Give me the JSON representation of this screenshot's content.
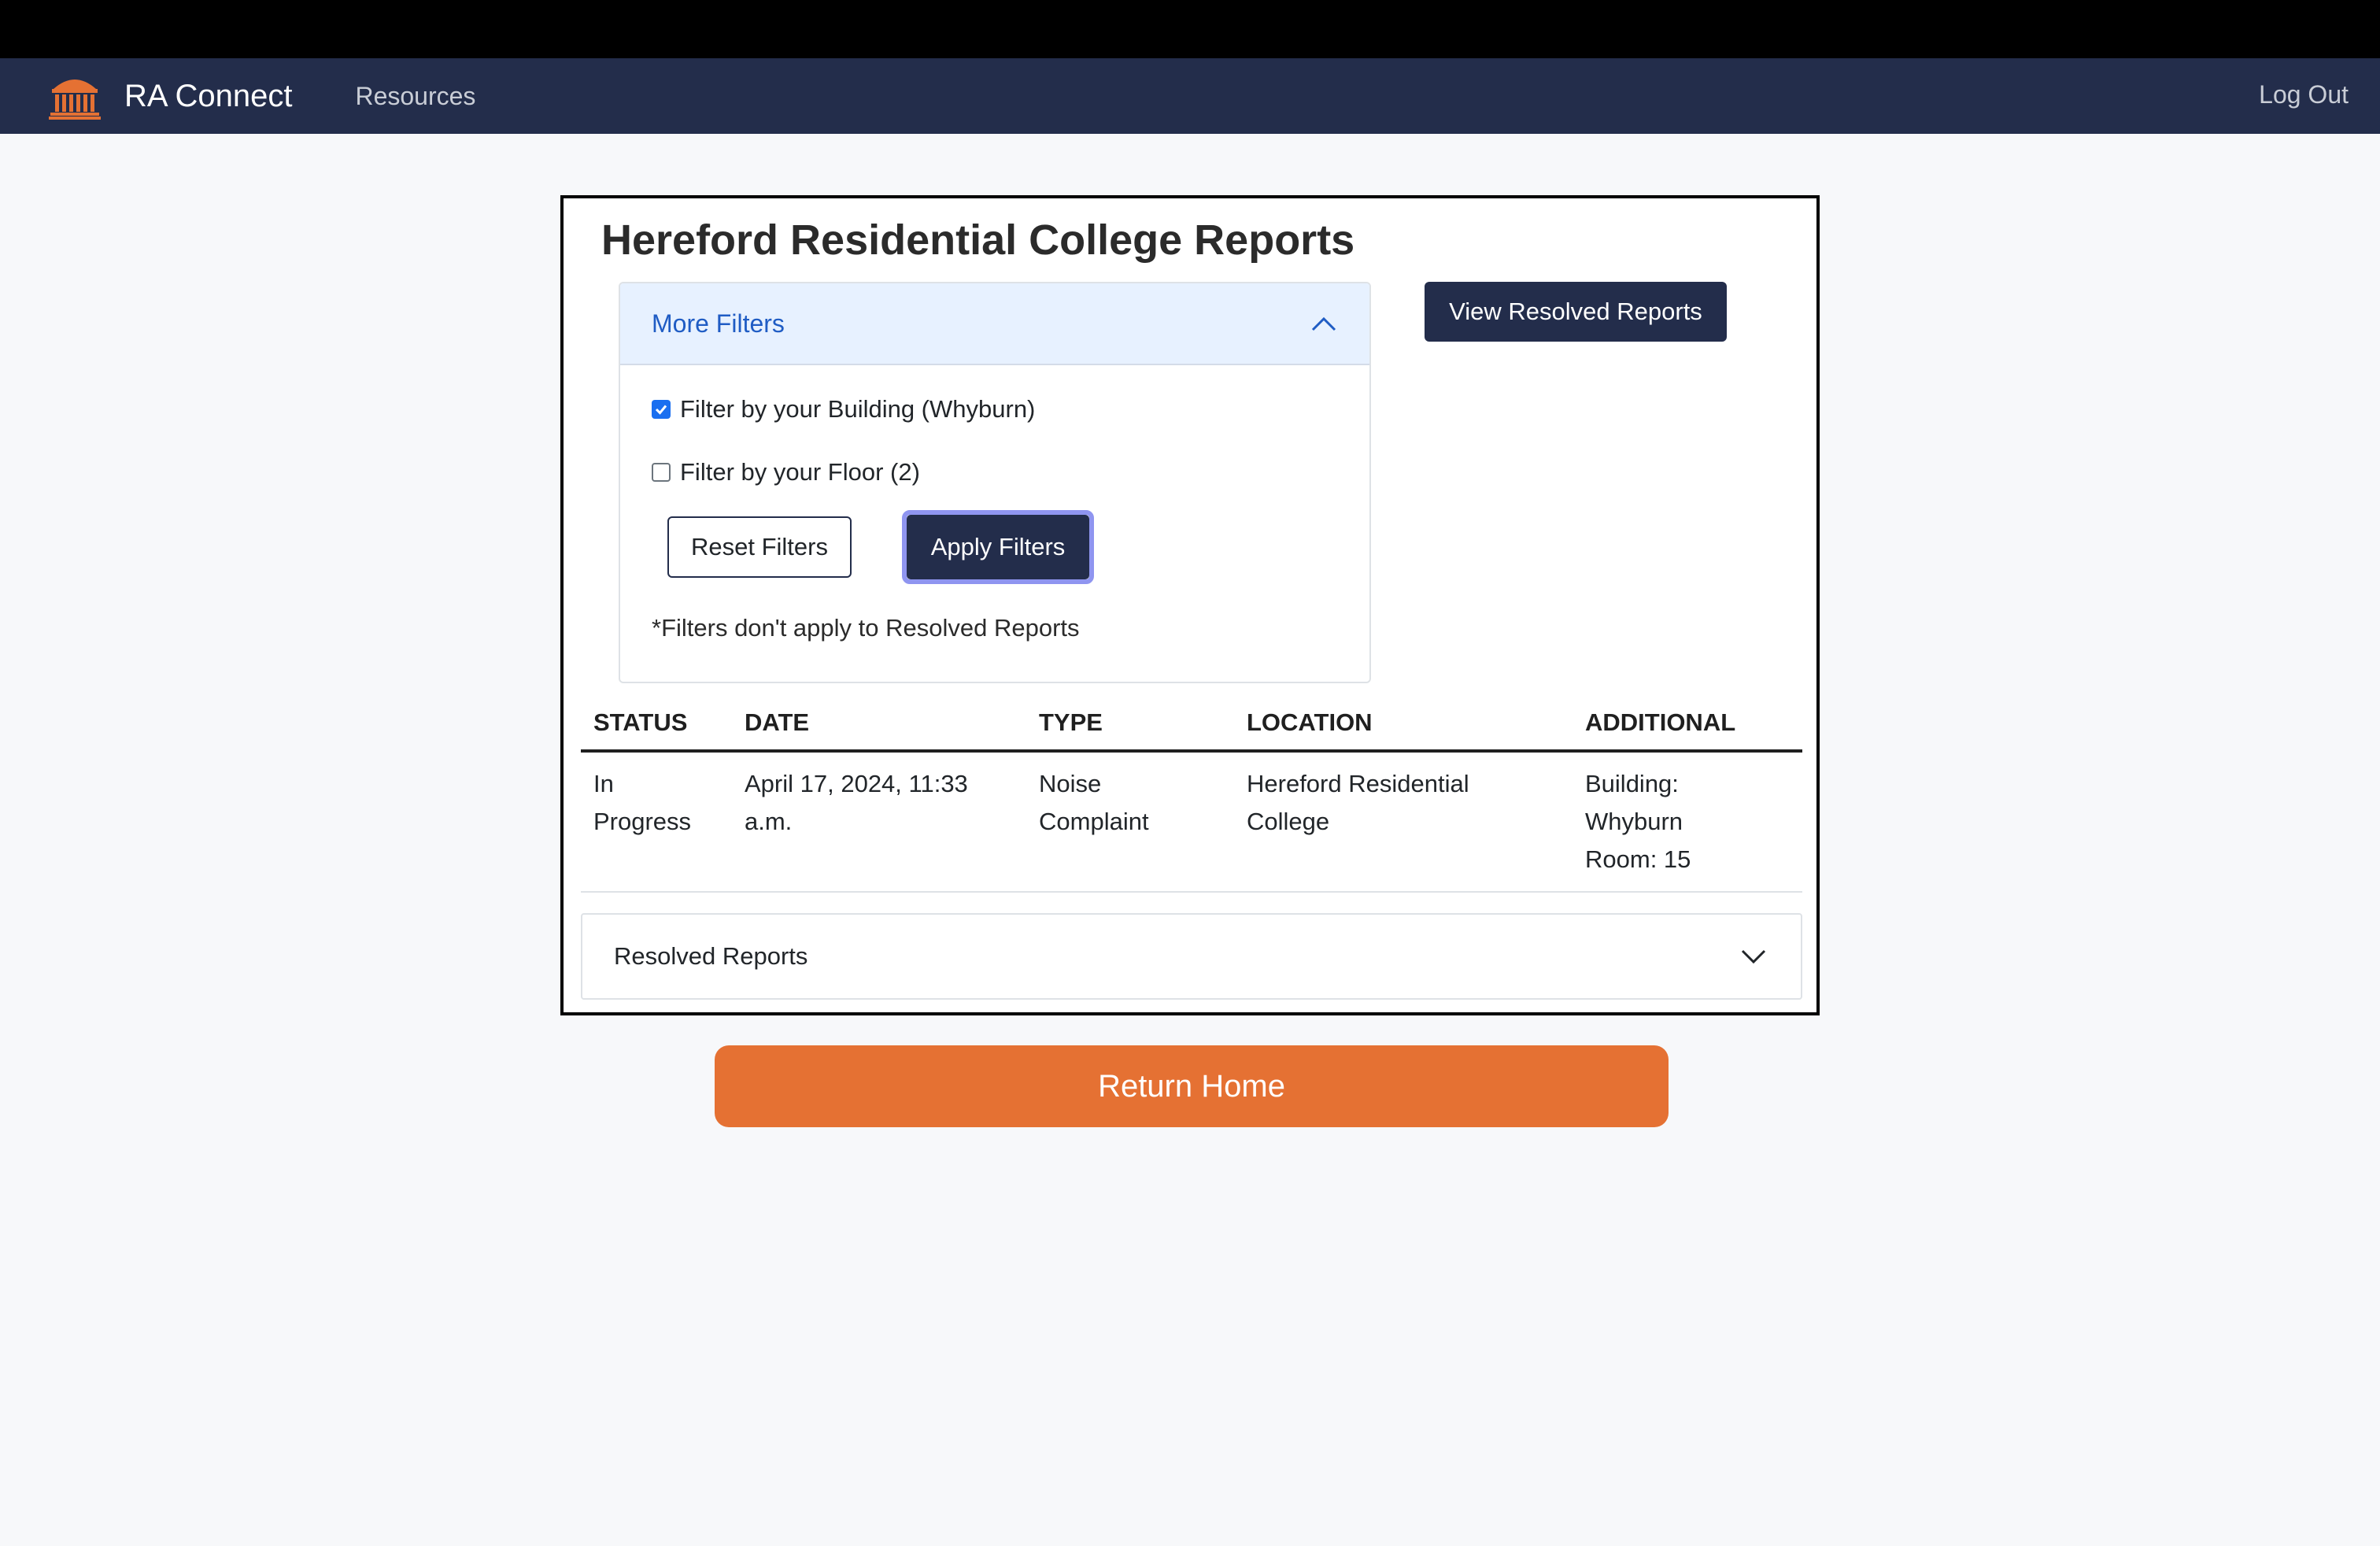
{
  "navbar": {
    "brand": "RA Connect",
    "logo_icon": "rotunda-logo-icon",
    "resources_label": "Resources",
    "logout_label": "Log Out"
  },
  "page": {
    "title": "Hereford Residential College Reports"
  },
  "filters": {
    "header_label": "More Filters",
    "expanded": true,
    "building_label": "Filter by your Building (Whyburn)",
    "building_checked": true,
    "floor_label": "Filter by your Floor (2)",
    "floor_checked": false,
    "reset_label": "Reset Filters",
    "apply_label": "Apply Filters",
    "note": "*Filters don't apply to Resolved Reports"
  },
  "view_resolved_label": "View Resolved Reports",
  "table": {
    "headers": [
      "STATUS",
      "DATE",
      "TYPE",
      "LOCATION",
      "ADDITIONAL"
    ],
    "rows": [
      {
        "status_lines": [
          "In",
          "Progress"
        ],
        "date_lines": [
          "April 17, 2024, 11:33",
          "a.m."
        ],
        "type_lines": [
          "Noise",
          "Complaint"
        ],
        "location_lines": [
          "Hereford Residential",
          "College"
        ],
        "additional_lines": [
          "Building:",
          "Whyburn",
          "Room: 15"
        ]
      }
    ]
  },
  "resolved_section": {
    "label": "Resolved Reports",
    "expanded": false
  },
  "return_home_label": "Return Home",
  "colors": {
    "navbar": "#232d4b",
    "accent_orange": "#e57133",
    "filter_header_bg": "#e7f1ff",
    "filter_header_text": "#1f5cc4"
  }
}
